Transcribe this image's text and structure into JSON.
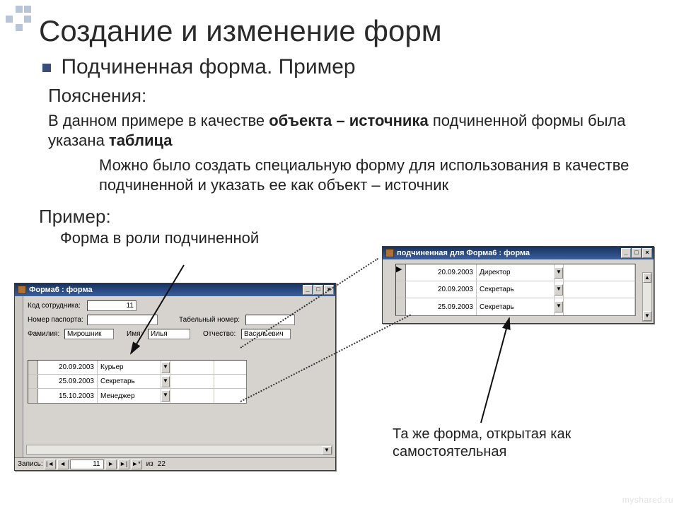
{
  "page": {
    "title": "Создание и изменение форм",
    "subtitle": "Подчиненная форма. Пример",
    "notes_label": "Пояснения:",
    "notes_p1_pre": "В данном примере в качестве ",
    "notes_p1_b1": "объекта – источника",
    "notes_p1_mid": " подчиненной формы была указана ",
    "notes_p1_b2": "таблица",
    "notes_p2": "Можно было создать специальную форму для использования в качестве подчиненной и указать ее как объект – источник",
    "example_label": "Пример:",
    "example_sub": "Форма в роли подчиненной",
    "caption2": "Та же форма, открытая как самостоятельная",
    "watermark": "myshared.ru"
  },
  "win1": {
    "title": "Форма6 : форма",
    "labels": {
      "code": "Код сотрудника:",
      "passport": "Номер паспорта:",
      "tab": "Табельный номер:",
      "surname": "Фамилия:",
      "name": "Имя:",
      "patr": "Отчество:"
    },
    "values": {
      "code": "11",
      "passport": "",
      "tab": "",
      "surname": "Мирошник",
      "name": "Илья",
      "patr": "Васильевич"
    },
    "grid": [
      {
        "date": "20.09.2003",
        "role": "Курьер"
      },
      {
        "date": "25.09.2003",
        "role": "Секретарь"
      },
      {
        "date": "15.10.2003",
        "role": "Менеджер"
      }
    ],
    "nav": {
      "label": "Запись:",
      "current": "11",
      "of_label": "из",
      "total": "22"
    }
  },
  "win2": {
    "title": "подчиненная для Форма6 : форма",
    "grid": [
      {
        "date": "20.09.2003",
        "role": "Директор"
      },
      {
        "date": "20.09.2003",
        "role": "Секретарь"
      },
      {
        "date": "25.09.2003",
        "role": "Секретарь"
      }
    ]
  },
  "glyphs": {
    "min": "_",
    "max": "□",
    "close": "×",
    "first": "|◄",
    "prev": "◄",
    "next": "►",
    "last": "►|",
    "new": "►*",
    "combo": "▼",
    "up": "▲",
    "down": "▼"
  }
}
